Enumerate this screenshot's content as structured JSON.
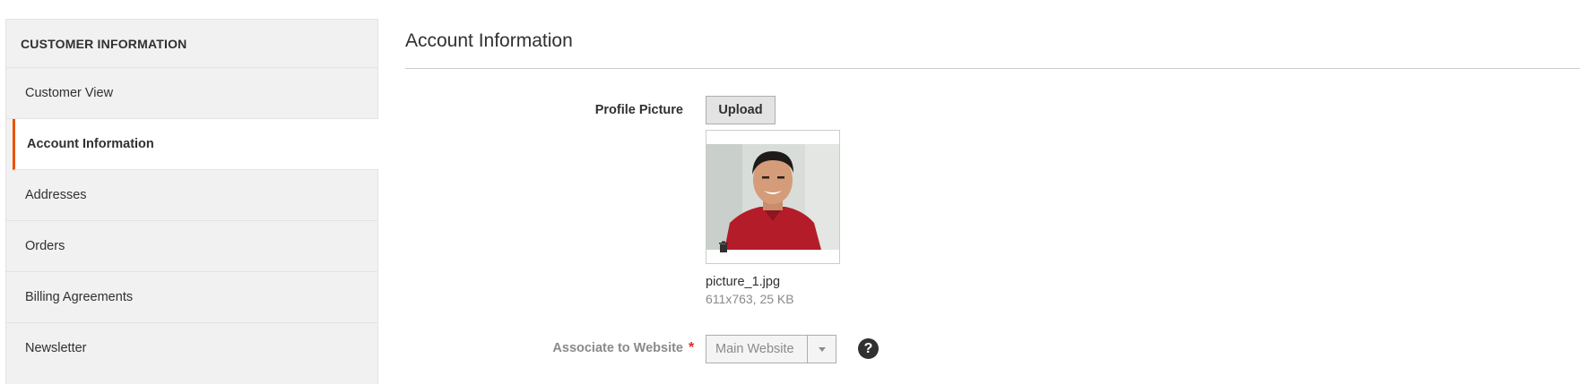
{
  "sidebar": {
    "title": "CUSTOMER INFORMATION",
    "items": [
      {
        "label": "Customer View"
      },
      {
        "label": "Account Information"
      },
      {
        "label": "Addresses"
      },
      {
        "label": "Orders"
      },
      {
        "label": "Billing Agreements"
      },
      {
        "label": "Newsletter"
      }
    ],
    "active_item": "Account Information",
    "accent_color": "#eb5202"
  },
  "main": {
    "section_title": "Account Information",
    "profile_picture": {
      "label": "Profile Picture",
      "upload_label": "Upload",
      "file_name": "picture_1.jpg",
      "file_meta": "611x763, 25 KB",
      "delete_icon": "trash-icon"
    },
    "website": {
      "label": "Associate to Website",
      "required_mark": "*",
      "selected": "Main Website",
      "help_icon": "question-circle-icon",
      "help_glyph": "?"
    }
  }
}
